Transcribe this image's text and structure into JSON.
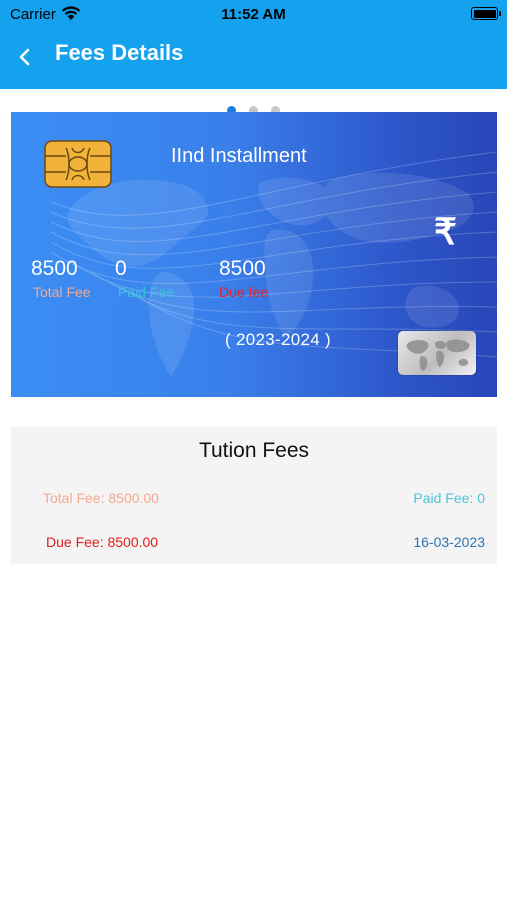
{
  "status_bar": {
    "carrier": "Carrier",
    "time": "11:52 AM"
  },
  "header": {
    "title": "Fees Details",
    "background_color": "#14a2ef"
  },
  "pager": {
    "page_count": 3,
    "active_index": 0,
    "active_color": "#1a7be0",
    "inactive_color": "#c7c7c7"
  },
  "card": {
    "title": "IInd Installment",
    "currency_symbol": "₹",
    "total_fee_value": "8500",
    "total_fee_label": "Total Fee",
    "paid_fee_value": "0",
    "paid_fee_label": "Paid Fee",
    "due_fee_value": "8500",
    "due_fee_label": "Due fee",
    "academic_year": "( 2023-2024 )",
    "colors": {
      "total_label": "#f6a88e",
      "paid_label": "#39c4d8",
      "due_label": "#e8212b"
    }
  },
  "fee_detail": {
    "title": "Tution Fees",
    "total_fee": "Total Fee: 8500.00",
    "paid_fee": "Paid Fee: 0",
    "due_fee": "Due Fee: 8500.00",
    "date": "16-03-2023",
    "colors": {
      "total": "#f6a88e",
      "paid": "#4ec3d6",
      "due": "#e01b1b",
      "date": "#2a74b4"
    }
  }
}
